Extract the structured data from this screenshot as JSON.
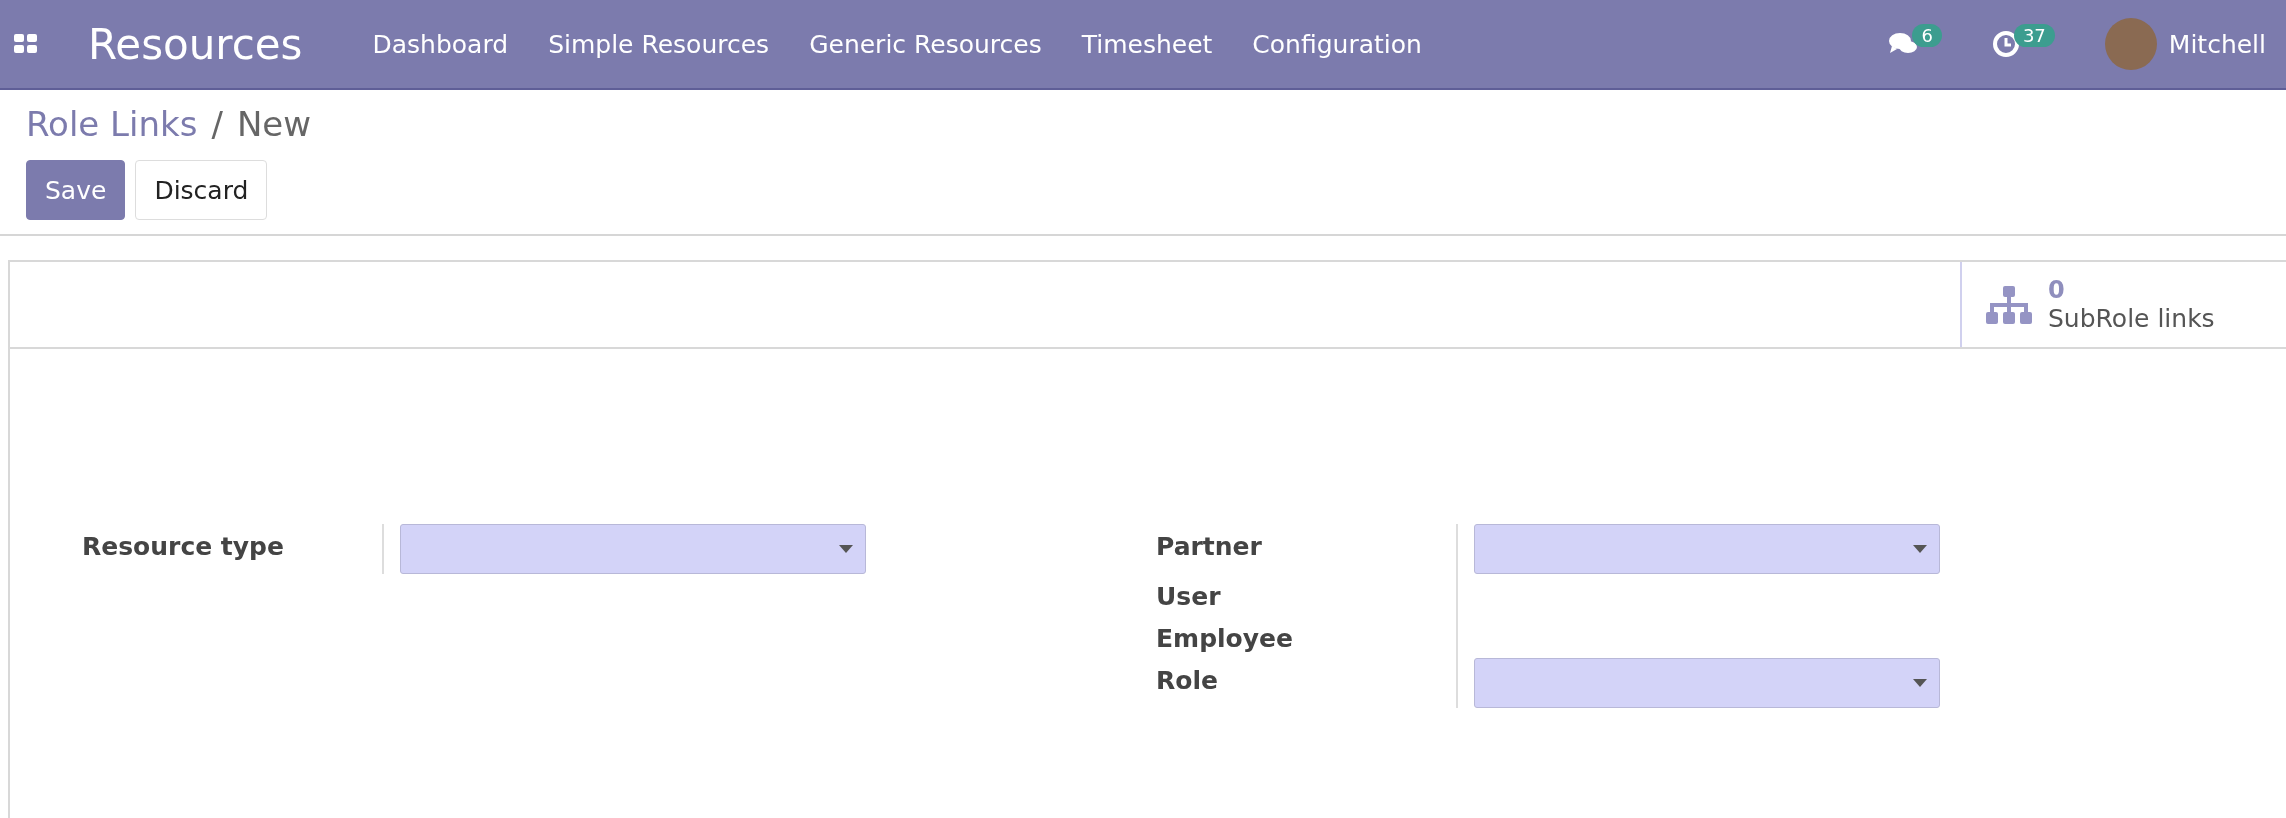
{
  "navbar": {
    "app_title": "Resources",
    "menu": [
      "Dashboard",
      "Simple Resources",
      "Generic Resources",
      "Timesheet",
      "Configuration"
    ],
    "messages_count": "6",
    "activities_count": "37",
    "user_name": "Mitchell"
  },
  "breadcrumb": {
    "parent": "Role Links",
    "separator": "/",
    "current": "New"
  },
  "buttons": [
    {
      "label": "Save",
      "kind": "primary"
    },
    {
      "label": "Discard",
      "kind": "secondary"
    }
  ],
  "stat_button": {
    "value": "0",
    "label": "SubRole links"
  },
  "left_group": [
    {
      "label": "Resource type",
      "kind": "select"
    }
  ],
  "right_group": [
    {
      "label": "Partner",
      "kind": "select"
    },
    {
      "label": "User",
      "kind": "empty"
    },
    {
      "label": "Employee",
      "kind": "empty"
    },
    {
      "label": "Role",
      "kind": "select"
    }
  ]
}
